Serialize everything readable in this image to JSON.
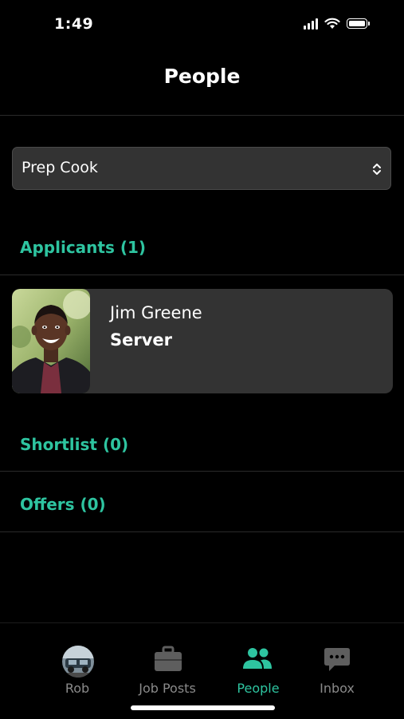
{
  "status_bar": {
    "time": "1:49"
  },
  "header": {
    "title": "People"
  },
  "job_selector": {
    "value": "Prep Cook"
  },
  "sections": {
    "applicants": {
      "label": "Applicants (1)"
    },
    "shortlist": {
      "label": "Shortlist (0)"
    },
    "offers": {
      "label": "Offers (0)"
    }
  },
  "applicants": [
    {
      "name": "Jim Greene",
      "role": "Server"
    }
  ],
  "tabbar": {
    "items": [
      {
        "label": "Rob",
        "icon": "profile-avatar-icon"
      },
      {
        "label": "Job Posts",
        "icon": "briefcase-icon"
      },
      {
        "label": "People",
        "icon": "people-icon"
      },
      {
        "label": "Inbox",
        "icon": "chat-icon"
      }
    ],
    "active": "People"
  },
  "colors": {
    "accent": "#2ec4a0",
    "background": "#000000",
    "card": "#333333",
    "inactive": "#8a8a8a"
  }
}
